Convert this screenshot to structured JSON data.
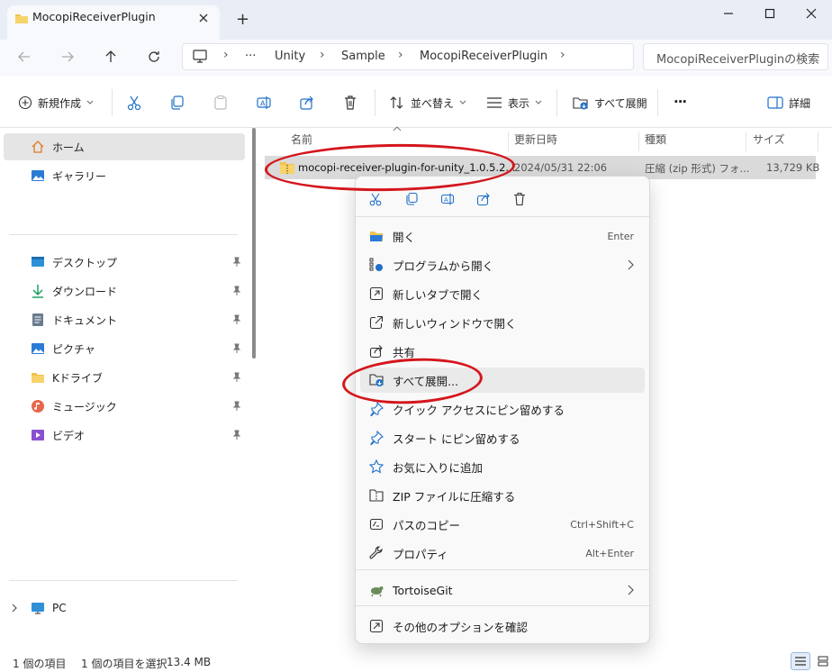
{
  "window": {
    "tab_title": "MocopiReceiverPlugin",
    "new_tab_symbol": "+"
  },
  "address": {
    "more": "···",
    "crumbs": [
      "Unity",
      "Sample",
      "MocopiReceiverPlugin"
    ],
    "search_placeholder": "MocopiReceiverPluginの検索"
  },
  "toolbar": {
    "new_label": "新規作成",
    "sort_label": "並べ替え",
    "view_label": "表示",
    "extract_all_label": "すべて展開",
    "more_label": "···",
    "details_label": "詳細"
  },
  "sidebar": {
    "home": "ホーム",
    "gallery": "ギャラリー",
    "pinned": [
      "デスクトップ",
      "ダウンロード",
      "ドキュメント",
      "ピクチャ",
      "Kドライブ",
      "ミュージック",
      "ビデオ"
    ],
    "pc": "PC"
  },
  "columns": {
    "name": "名前",
    "date": "更新日時",
    "type": "種類",
    "size": "サイズ"
  },
  "file": {
    "name": "mocopi-receiver-plugin-for-unity_1.0.5.2...",
    "date": "2024/05/31 22:06",
    "type": "圧縮 (zip 形式) フォ...",
    "size": "13,729 KB"
  },
  "status": {
    "count": "1 個の項目",
    "selected": "1 個の項目を選択",
    "size": "13.4 MB"
  },
  "context_menu": {
    "items": [
      {
        "label": "開く",
        "accel": "Enter"
      },
      {
        "label": "プログラムから開く"
      },
      {
        "label": "新しいタブで開く"
      },
      {
        "label": "新しいウィンドウで開く"
      },
      {
        "label": "共有"
      },
      {
        "label": "すべて展開..."
      },
      {
        "label": "クイック アクセスにピン留めする"
      },
      {
        "label": "スタート にピン留めする"
      },
      {
        "label": "お気に入りに追加"
      },
      {
        "label": "ZIP ファイルに圧縮する"
      },
      {
        "label": "パスのコピー",
        "accel": "Ctrl+Shift+C"
      },
      {
        "label": "プロパティ",
        "accel": "Alt+Enter"
      },
      {
        "label": "TortoiseGit"
      },
      {
        "label": "その他のオプションを確認"
      }
    ]
  },
  "colors": {
    "annotation_red": "#d4161d",
    "folder_yellow": "#f2c14e",
    "accent_blue": "#1e70c8"
  }
}
